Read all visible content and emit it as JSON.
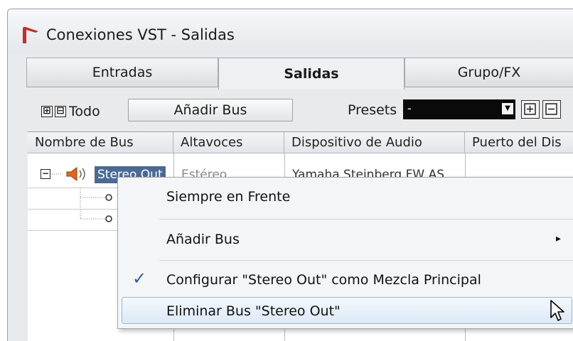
{
  "window": {
    "title": "Conexiones VST - Salidas"
  },
  "tabs": [
    {
      "label": "Entradas",
      "active": false
    },
    {
      "label": "Salidas",
      "active": true
    },
    {
      "label": "Grupo/FX",
      "active": false
    }
  ],
  "toolbar": {
    "expand_all": "⊞",
    "collapse_all": "⊟",
    "all_label": "Todo",
    "add_bus_label": "Añadir Bus",
    "presets_label": "Presets",
    "presets_value": "-"
  },
  "table": {
    "columns": [
      "Nombre de Bus",
      "Altavoces",
      "Dispositivo de Audio",
      "Puerto del Dis"
    ],
    "rows": [
      {
        "name": "Stereo Out",
        "speakers": "Estéreo",
        "device": "Yamaha Steinberg FW AS"
      }
    ]
  },
  "context_menu": {
    "items": [
      {
        "label": "Siempre en Frente",
        "checked": false,
        "submenu": false
      },
      {
        "label": "Añadir Bus",
        "checked": false,
        "submenu": true
      },
      {
        "label": "Configurar \"Stereo Out\" como Mezcla Principal",
        "checked": true,
        "submenu": false
      },
      {
        "label": "Eliminar Bus \"Stereo Out\"",
        "checked": false,
        "submenu": false,
        "hovered": true
      }
    ],
    "check_glyph": "✓",
    "submenu_glyph": "▸"
  },
  "colors": {
    "selection": "#4b6a94",
    "menu_hover": "#dde9f6",
    "check": "#2a5ea8",
    "logo": "#c0302b"
  }
}
